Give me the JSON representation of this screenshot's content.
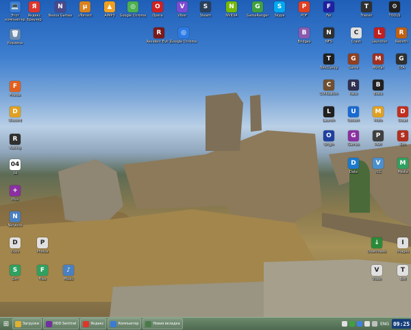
{
  "desktop_icons": [
    {
      "label": "Этот компьютер",
      "icon": "computer-icon",
      "color": "#3a7bd5",
      "glyph": "💻"
    },
    {
      "label": "Яндекс Браузер",
      "icon": "yandex-browser-icon",
      "color": "#e0352b",
      "glyph": "Я"
    },
    {
      "label": "Nexus Games",
      "icon": "nexus-icon",
      "color": "#4a4a8a",
      "glyph": "N"
    },
    {
      "label": "uTorrent",
      "icon": "utorrent-icon",
      "color": "#d9821e",
      "glyph": "µ"
    },
    {
      "label": "AIMP3",
      "icon": "aimp-icon",
      "color": "#f0a020",
      "glyph": "▲"
    },
    {
      "label": "Google Chrome",
      "icon": "chrome-icon",
      "color": "#4caf50",
      "glyph": "◎"
    },
    {
      "label": "Opera",
      "icon": "opera-icon",
      "color": "#d02020",
      "glyph": "O"
    },
    {
      "label": "Viber",
      "icon": "viber-icon",
      "color": "#7b4bd1",
      "glyph": "V"
    },
    {
      "label": "Steam",
      "icon": "steam-icon",
      "color": "#2a3f5a",
      "glyph": "S"
    },
    {
      "label": "NVIDIA",
      "icon": "nvidia-icon",
      "color": "#76b900",
      "glyph": "N"
    },
    {
      "label": "GameRanger",
      "icon": "gameranger-icon",
      "color": "#40a040",
      "glyph": "G"
    },
    {
      "label": "Skype",
      "icon": "skype-icon",
      "color": "#00a9f0",
      "glyph": "S"
    },
    {
      "label": "PDF",
      "icon": "pdf-icon",
      "color": "#e04020",
      "glyph": "P"
    },
    {
      "label": "Far",
      "icon": "far-icon",
      "color": "#2020a0",
      "glyph": "F"
    },
    {
      "label": "Trainer",
      "icon": "trainer-icon",
      "color": "#303030",
      "glyph": "T"
    },
    {
      "label": "TOOLS",
      "icon": "tools-icon",
      "color": "#202020",
      "glyph": "⚙"
    },
    {
      "label": "Корзина",
      "icon": "recycle-bin-icon",
      "color": "#6a8ab0",
      "glyph": "🗑"
    },
    {
      "label": "Resident Evil 2",
      "icon": "resident-evil-icon",
      "color": "#7a1a1a",
      "glyph": "R"
    },
    {
      "label": "Google Chrome",
      "icon": "chrome-icon-2",
      "color": "#2c7be5",
      "glyph": "◎"
    },
    {
      "label": "Bridges",
      "icon": "bridges-icon",
      "color": "#8a5ab0",
      "glyph": "B"
    },
    {
      "label": "NFS",
      "icon": "nfs-icon",
      "color": "#303030",
      "glyph": "N"
    },
    {
      "label": "Crash",
      "icon": "crash-icon",
      "color": "#e0e0e0",
      "glyph": "C"
    },
    {
      "label": "Launcher",
      "icon": "launcher-icon",
      "color": "#c02020",
      "glyph": "L"
    },
    {
      "label": "Rebirth",
      "icon": "rebirth-icon",
      "color": "#c06010",
      "glyph": "R"
    },
    {
      "label": "TomClancy",
      "icon": "tomclancy-icon",
      "color": "#202020",
      "glyph": "T"
    },
    {
      "label": "Game",
      "icon": "game-icon",
      "color": "#904020",
      "glyph": "G"
    },
    {
      "label": "Mortal",
      "icon": "mortal-icon",
      "color": "#a03020",
      "glyph": "M"
    },
    {
      "label": "GTA",
      "icon": "gta-icon",
      "color": "#303030",
      "glyph": "G"
    },
    {
      "label": "Firefox",
      "icon": "firefox-icon",
      "color": "#e06020",
      "glyph": "F"
    },
    {
      "label": "Civilization",
      "icon": "civ-icon",
      "color": "#705030",
      "glyph": "C"
    },
    {
      "label": "Race",
      "icon": "race-icon",
      "color": "#303050",
      "glyph": "R"
    },
    {
      "label": "Black",
      "icon": "black-icon",
      "color": "#202020",
      "glyph": "B"
    },
    {
      "label": "Discord",
      "icon": "discord-icon",
      "color": "#e0a020",
      "glyph": "D"
    },
    {
      "label": "Launch",
      "icon": "launch-icon",
      "color": "#202020",
      "glyph": "L"
    },
    {
      "label": "Ubisoft",
      "icon": "ubisoft-icon",
      "color": "#1a6ad0",
      "glyph": "U"
    },
    {
      "label": "Moto",
      "icon": "moto-icon",
      "color": "#e0a020",
      "glyph": "M"
    },
    {
      "label": "Dead",
      "icon": "dead-icon",
      "color": "#c03020",
      "glyph": "D"
    },
    {
      "label": "Racing",
      "icon": "racing-icon",
      "color": "#303030",
      "glyph": "R"
    },
    {
      "label": "Origin",
      "icon": "origin-icon",
      "color": "#2040a0",
      "glyph": "O"
    },
    {
      "label": "Games",
      "icon": "games-icon",
      "color": "#8a30a0",
      "glyph": "G"
    },
    {
      "label": "PAM",
      "icon": "pam-icon",
      "color": "#404040",
      "glyph": "P"
    },
    {
      "label": "Sim",
      "icon": "sim-icon",
      "color": "#b03020",
      "glyph": "S"
    },
    {
      "label": "04",
      "icon": "calendar-icon",
      "color": "#ffffff",
      "glyph": "04"
    },
    {
      "label": "Data",
      "icon": "data-icon",
      "color": "#1a7ad0",
      "glyph": "D"
    },
    {
      "label": "VLC",
      "icon": "vlc-icon",
      "color": "#4a90d0",
      "glyph": "V"
    },
    {
      "label": "Media",
      "icon": "media-icon",
      "color": "#30a060",
      "glyph": "M"
    },
    {
      "label": "Plus",
      "icon": "plus-icon",
      "color": "#8a30a0",
      "glyph": "+"
    },
    {
      "label": "Downloads",
      "icon": "downloads-icon",
      "color": "#2a8a3a",
      "glyph": "↓"
    },
    {
      "label": "Images",
      "icon": "images-icon",
      "color": "#e0e0e0",
      "glyph": "I"
    },
    {
      "label": "Network",
      "icon": "network-icon",
      "color": "#4a80c0",
      "glyph": "N"
    },
    {
      "label": "Docs",
      "icon": "docs-icon",
      "color": "#e0e0e0",
      "glyph": "D"
    },
    {
      "label": "Photos",
      "icon": "photos-icon",
      "color": "#e0e0e0",
      "glyph": "P"
    },
    {
      "label": "Sim",
      "icon": "sim2-icon",
      "color": "#30a060",
      "glyph": "S"
    },
    {
      "label": "Files",
      "icon": "files-icon",
      "color": "#30a060",
      "glyph": "F"
    },
    {
      "label": "Music",
      "icon": "music-icon",
      "color": "#4a80c0",
      "glyph": "♪"
    },
    {
      "label": "Video",
      "icon": "video-icon",
      "color": "#e0e0e0",
      "glyph": "V"
    },
    {
      "label": "Text",
      "icon": "text-icon",
      "color": "#e0e0e0",
      "glyph": "T"
    }
  ],
  "taskbar": {
    "tasks": [
      {
        "label": "Загрузки",
        "icon": "folder-icon",
        "color": "#e0b030"
      },
      {
        "label": "HDD Sentinel",
        "icon": "hdd-icon",
        "color": "#7030a0"
      },
      {
        "label": "Яндекс",
        "icon": "yandex-icon",
        "color": "#e0352b"
      },
      {
        "label": "Компьютер",
        "icon": "computer-task-icon",
        "color": "#3a7bd5"
      },
      {
        "label": "Новая вкладка",
        "icon": "browser-tab-icon",
        "color": "#4a7a4a"
      }
    ],
    "tray_icons": [
      "#e0e0e0",
      "#40a040",
      "#4080e0",
      "#e0e0e0",
      "#c0c0c0"
    ],
    "tray_language": "ENG",
    "clock": "09:25"
  }
}
